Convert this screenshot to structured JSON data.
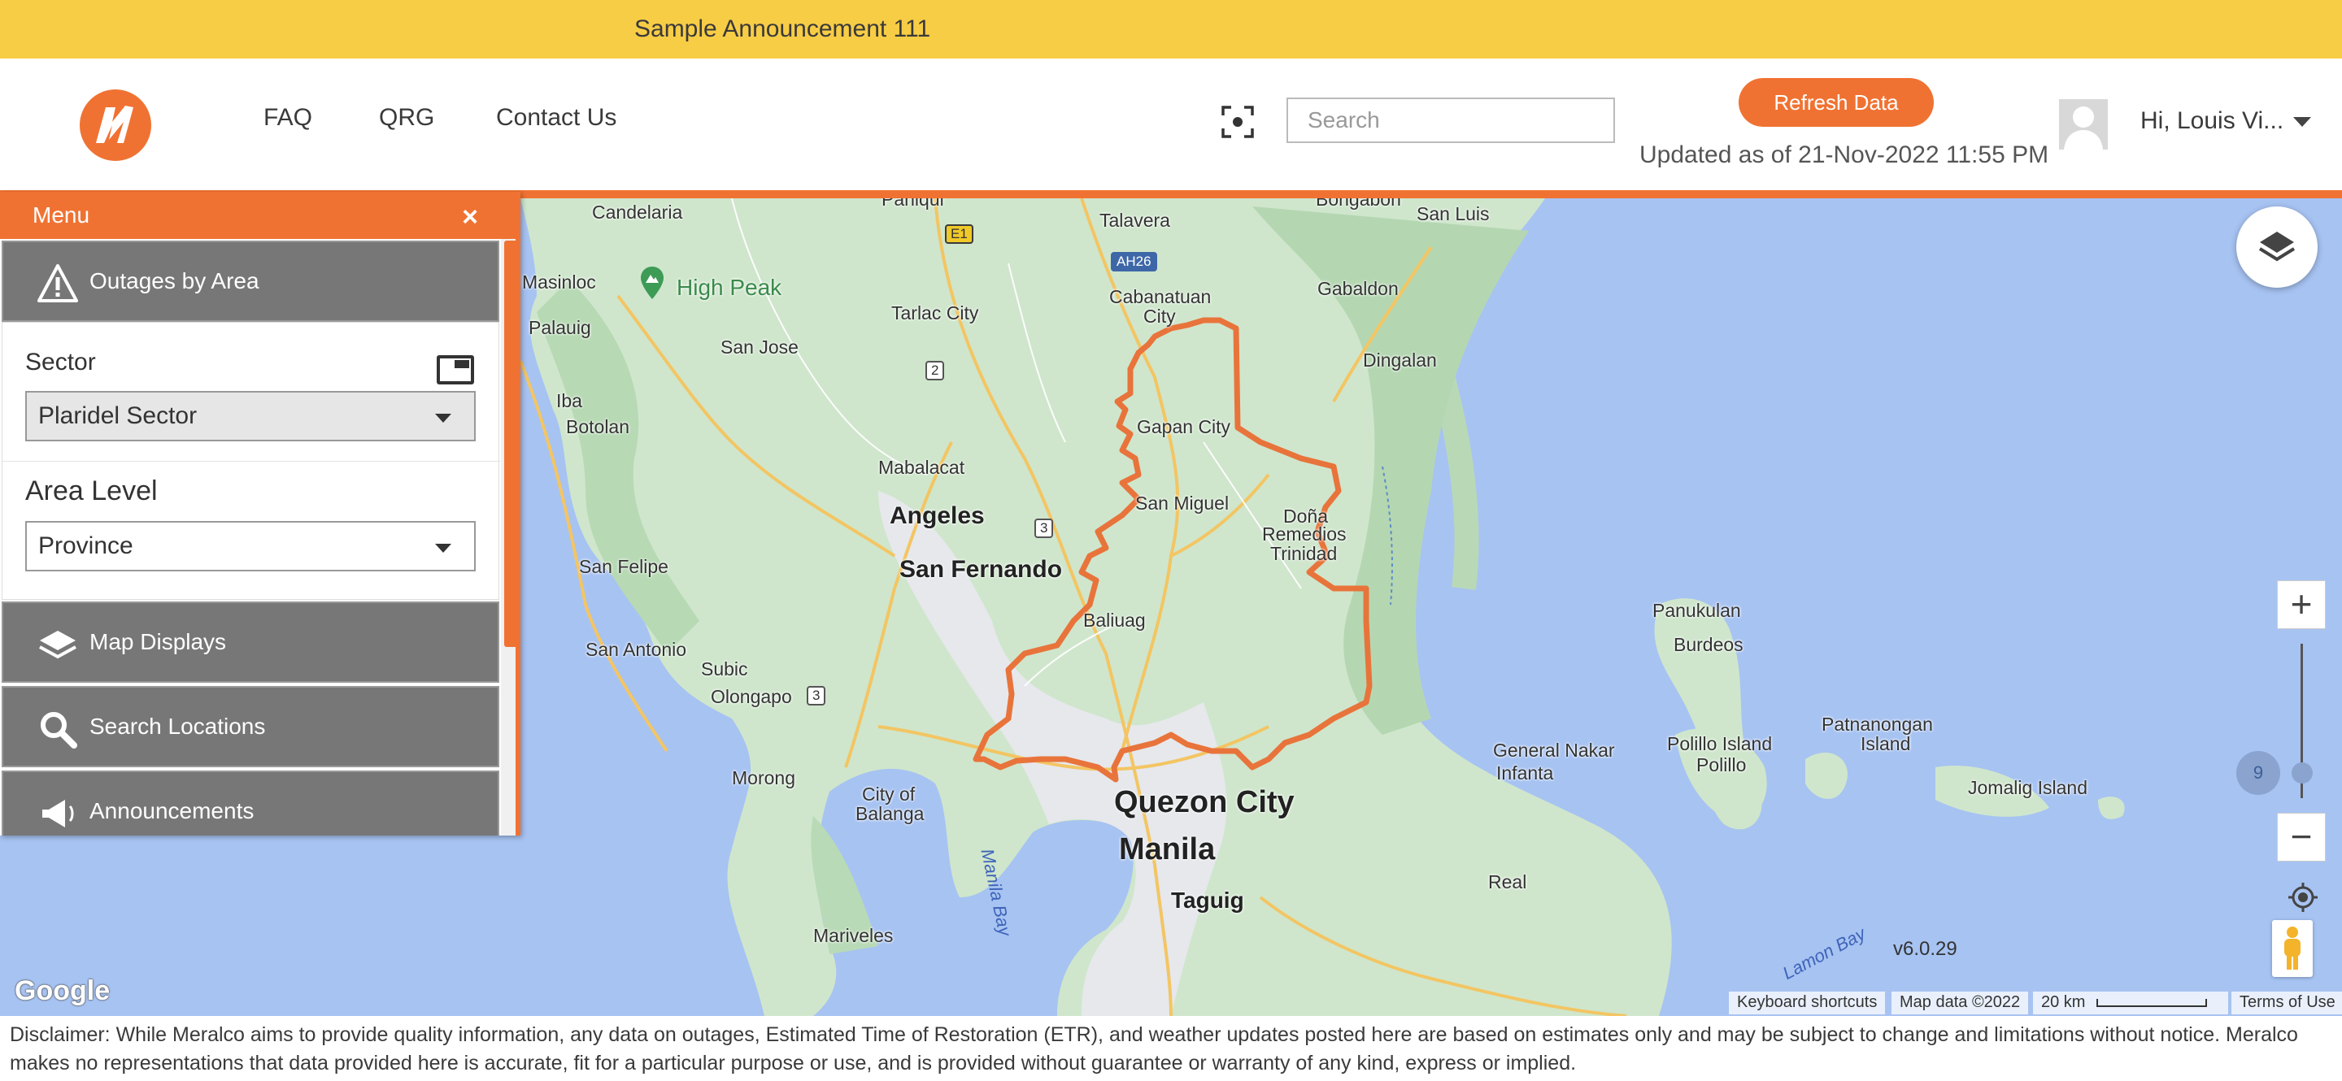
{
  "announcement": "Sample Announcement 111",
  "header": {
    "nav": [
      "FAQ",
      "QRG",
      "Contact Us"
    ],
    "search_placeholder": "Search",
    "refresh_label": "Refresh Data",
    "updated_text": "Updated as of 21-Nov-2022 11:55 PM",
    "user_greeting": "Hi, Louis Vi..."
  },
  "sidebar": {
    "title": "Menu",
    "close": "×",
    "sections": {
      "outages": "Outages by Area",
      "map_displays": "Map Displays",
      "search_locations": "Search Locations",
      "announcements": "Announcements"
    },
    "sector_label": "Sector",
    "sector_value": "Plaridel Sector",
    "area_level_label": "Area Level",
    "area_level_value": "Province"
  },
  "map": {
    "labels": {
      "candelaria": "Candelaria",
      "paniqui": "Paniqui",
      "talavera": "Talavera",
      "bongabon": "Bongabon",
      "san_luis": "San Luis",
      "masinloc": "Masinloc",
      "high_peak": "High Peak",
      "palauig": "Palauig",
      "tarlac": "Tarlac City",
      "cabanatuan": "Cabanatuan",
      "cabanatuan2": "City",
      "gabaldon": "Gabaldon",
      "san_jose": "San Jose",
      "dingalan": "Dingalan",
      "iba": "Iba",
      "botolan": "Botolan",
      "gapan": "Gapan City",
      "mabalacat": "Mabalacat",
      "san_miguel": "San Miguel",
      "angeles": "Angeles",
      "dona": "Doña",
      "remedios": "Remedios",
      "trinidad": "Trinidad",
      "san_felipe": "San Felipe",
      "san_fernando": "San Fernando",
      "panukulan": "Panukulan",
      "baliuag": "Baliuag",
      "san_antonio": "San Antonio",
      "burdeos": "Burdeos",
      "subic": "Subic",
      "olongapo": "Olongapo",
      "patnanongan": "Patnanongan",
      "patnanongan2": "Island",
      "general_nakar": "General Nakar",
      "infanta": "Infanta",
      "polillo_island": "Polillo Island",
      "polillo": "Polillo",
      "jomalig": "Jomalig Island",
      "morong": "Morong",
      "city_of": "City of",
      "balanga": "Balanga",
      "quezon_city": "Quezon City",
      "manila": "Manila",
      "manila_bay": "Manila Bay",
      "taguig": "Taguig",
      "real": "Real",
      "mariveles": "Mariveles",
      "lamon_bay": "Lamon Bay"
    },
    "shields": {
      "e1": "E1",
      "ah26": "AH26",
      "r2": "2",
      "r3a": "3",
      "r3b": "3"
    },
    "zoom_level": "9",
    "version": "v6.0.29",
    "google": "Google",
    "attribution": {
      "keyboard": "Keyboard shortcuts",
      "map_data": "Map data ©2022",
      "scale": "20 km",
      "terms": "Terms of Use"
    },
    "colors": {
      "water": "#a7c3f2",
      "land": "#cfe6cc",
      "boundary": "#e8743b"
    }
  },
  "footer": {
    "disclaimer": "Disclaimer: While Meralco aims to provide quality information, any data on outages, Estimated Time of Restoration (ETR), and weather updates posted here are based on estimates only and may be subject to change and limitations without notice. Meralco makes no representations that data provided here is accurate, fit for a particular purpose or use, and is provided without guarantee or warranty of any kind, express or implied."
  }
}
